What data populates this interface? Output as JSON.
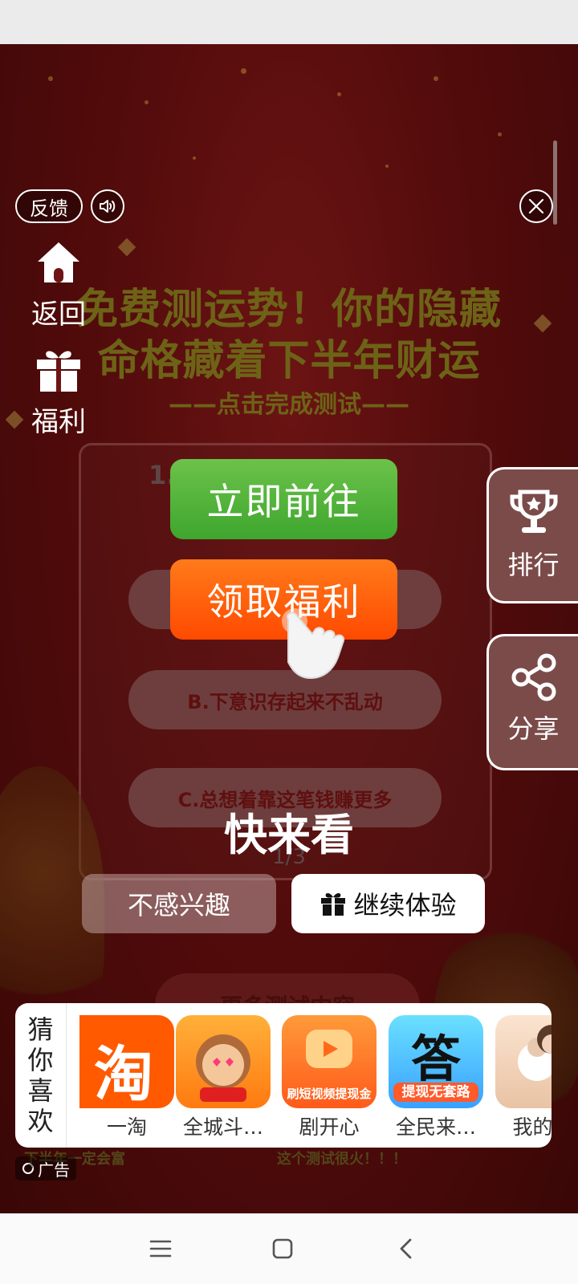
{
  "background": {
    "title_line1": "免费测运势！你的隐藏",
    "title_line2": "命格藏着下半年财运",
    "subtitle": "——点击完成测试——",
    "question": "1.",
    "option_b": "B.下意识存起来不乱动",
    "option_c": "C.总想着靠这笔钱赚更多",
    "page_indicator": "1/3",
    "more_tests": "更多测试内容",
    "bottom_left_text": "下半年一定会富",
    "bottom_right_text": "这个测试很火！！！"
  },
  "top_controls": {
    "feedback": "反馈",
    "sound_icon": "speaker-icon",
    "close_icon": "close-icon"
  },
  "side_nav": {
    "home_label": "返回",
    "gift_label": "福利"
  },
  "right_tabs": {
    "rank_label": "排行",
    "share_label": "分享"
  },
  "cta": {
    "go_label": "立即前往",
    "gift_label": "领取福利"
  },
  "prompt": {
    "headline": "快来看",
    "dismiss_label": "不感兴趣",
    "continue_label": "继续体验"
  },
  "recommend": {
    "label": [
      "猜",
      "你",
      "喜",
      "欢"
    ],
    "apps": [
      {
        "name": "一淘",
        "icon_text": "淘",
        "color": "#ff5a00"
      },
      {
        "name": "全城斗…",
        "icon_text": "",
        "color": "#ff8a1a"
      },
      {
        "name": "剧开心",
        "icon_text": "刷短视频提现金",
        "color": "#ff6a1a"
      },
      {
        "name": "全民来…",
        "icon_text": "答",
        "sub_text": "提现无套路",
        "color": "#3aa0ff"
      },
      {
        "name": "我的小",
        "icon_text": "",
        "color": "#f0d6c0"
      }
    ]
  },
  "ad_tag": "广告"
}
